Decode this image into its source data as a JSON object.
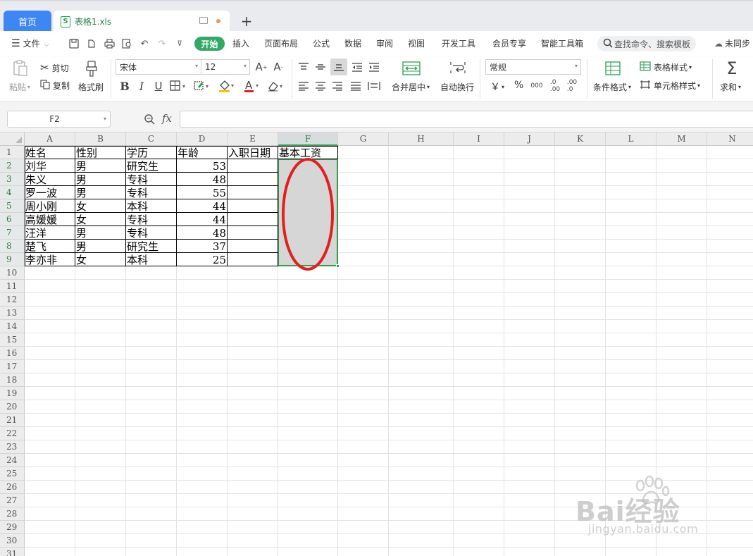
{
  "tabs": {
    "home": "首页",
    "file": "表格1.xls"
  },
  "menu": {
    "file": "文件",
    "items": [
      "开始",
      "插入",
      "页面布局",
      "公式",
      "数据",
      "审阅",
      "视图",
      "开发工具",
      "会员专享",
      "智能工具箱"
    ],
    "search_placeholder": "查找命令、搜索模板",
    "sync": "未同步"
  },
  "ribbon": {
    "paste": "粘贴",
    "cut": "剪切",
    "copy": "复制",
    "format_painter": "格式刷",
    "font_name": "宋体",
    "font_size": "12",
    "merge_center": "合并居中",
    "wrap_text": "自动换行",
    "number_format": "常规",
    "currency": "￥",
    "percent": "%",
    "cond_format": "条件格式",
    "table_style": "表格样式",
    "cell_style": "单元格样式",
    "sum": "求和"
  },
  "formula_bar": {
    "name_box": "F2",
    "fx": "fx",
    "formula": ""
  },
  "sheet": {
    "columns": [
      "A",
      "B",
      "C",
      "D",
      "E",
      "F",
      "G",
      "H",
      "I",
      "J",
      "K",
      "L",
      "M",
      "N"
    ],
    "rows": [
      "1",
      "2",
      "3",
      "4",
      "5",
      "6",
      "7",
      "8",
      "9",
      "10",
      "11",
      "12",
      "13",
      "14",
      "15",
      "16",
      "17",
      "18",
      "19",
      "20",
      "21",
      "22",
      "23",
      "24",
      "25",
      "26",
      "27",
      "28",
      "29",
      "30",
      "31"
    ],
    "active_column": "F",
    "headers": [
      "姓名",
      "性别",
      "学历",
      "年龄",
      "入职日期",
      "基本工资"
    ],
    "data": [
      [
        "刘华",
        "男",
        "研究生",
        "53",
        "",
        ""
      ],
      [
        "朱义",
        "男",
        "专科",
        "48",
        "",
        ""
      ],
      [
        "罗一波",
        "男",
        "专科",
        "55",
        "",
        ""
      ],
      [
        "周小刚",
        "女",
        "本科",
        "44",
        "",
        ""
      ],
      [
        "高媛媛",
        "女",
        "专科",
        "44",
        "",
        ""
      ],
      [
        "汪洋",
        "男",
        "专科",
        "48",
        "",
        ""
      ],
      [
        "楚飞",
        "男",
        "研究生",
        "37",
        "",
        ""
      ],
      [
        "李亦非",
        "女",
        "本科",
        "25",
        "",
        ""
      ]
    ],
    "selection": "F2:F9",
    "annotation_color": "#e02020"
  },
  "watermark": {
    "brand": "Bai经验",
    "url": "jingyan.baidu.com"
  },
  "colors": {
    "accent_blue": "#3f86f5",
    "start_green": "#30a965",
    "selection_green": "#3a9b4d"
  }
}
